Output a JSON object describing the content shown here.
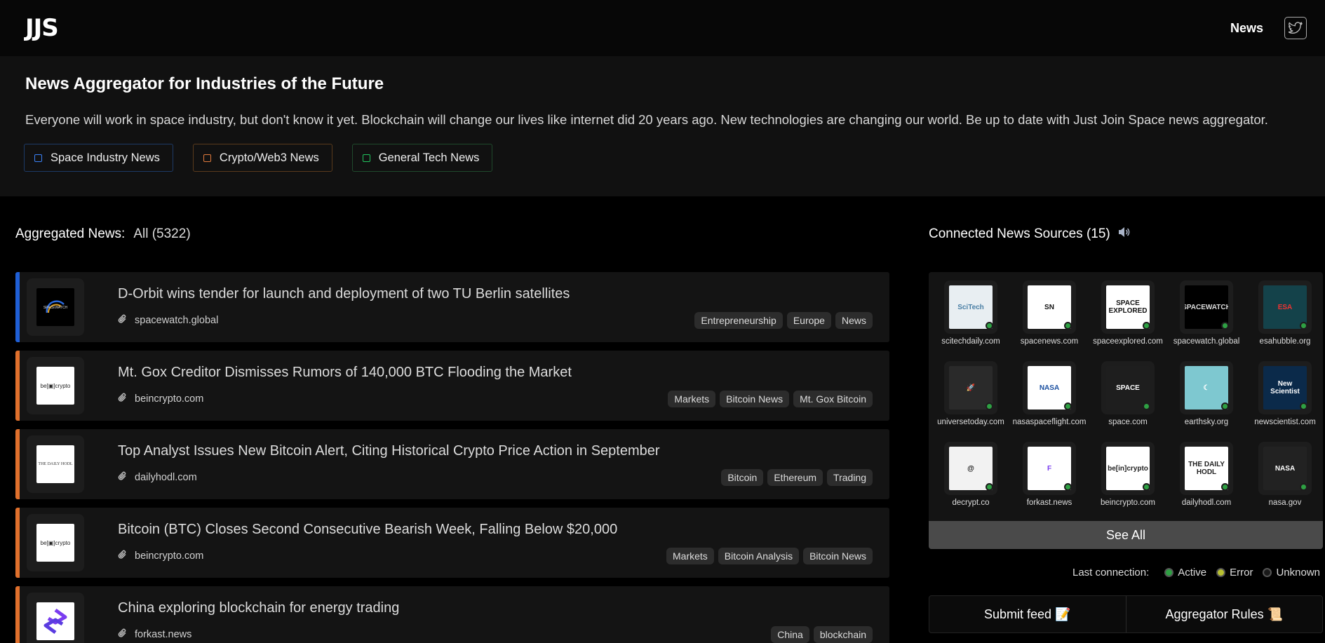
{
  "brand": {
    "logo": "JJS"
  },
  "nav": {
    "news": "News",
    "twitter_icon": "twitter-icon"
  },
  "hero": {
    "title": "News Aggregator for Industries of the Future",
    "description": "Everyone will work in space industry, but don't know it yet. Blockchain will change our lives like internet did 20 years ago. New technologies are changing our world. Be up to date with Just Join Space news aggregator.",
    "filters": [
      {
        "label": "Space Industry News",
        "color": "#3b82f6"
      },
      {
        "label": "Crypto/Web3 News",
        "color": "#e07a3c"
      },
      {
        "label": "General Tech News",
        "color": "#22c55e"
      }
    ]
  },
  "aggregated": {
    "title": "Aggregated News:",
    "filter": "All (5322)",
    "items": [
      {
        "title": "D-Orbit wins tender for launch and deployment of two TU Berlin satellites",
        "source": "spacewatch.global",
        "tags": [
          "Entrepreneurship",
          "Europe",
          "News"
        ],
        "accent": "#1f5fd6",
        "logo": "spacewatch"
      },
      {
        "title": "Mt. Gox Creditor Dismisses Rumors of 140,000 BTC Flooding the Market",
        "source": "beincrypto.com",
        "tags": [
          "Markets",
          "Bitcoin News",
          "Mt. Gox Bitcoin"
        ],
        "accent": "#e0702c",
        "logo": "beincrypto"
      },
      {
        "title": "Top Analyst Issues New Bitcoin Alert, Citing Historical Crypto Price Action in September",
        "source": "dailyhodl.com",
        "tags": [
          "Bitcoin",
          "Ethereum",
          "Trading"
        ],
        "accent": "#e0702c",
        "logo": "dailyhodl"
      },
      {
        "title": "Bitcoin (BTC) Closes Second Consecutive Bearish Week, Falling Below $20,000",
        "source": "beincrypto.com",
        "tags": [
          "Markets",
          "Bitcoin Analysis",
          "Bitcoin News"
        ],
        "accent": "#e0702c",
        "logo": "beincrypto"
      },
      {
        "title": "China exploring blockchain for energy trading",
        "source": "forkast.news",
        "tags": [
          "China",
          "blockchain"
        ],
        "accent": "#e0702c",
        "logo": "forkast"
      }
    ]
  },
  "sources": {
    "title": "Connected News Sources (15)",
    "speaker_icon": "speaker-icon",
    "items": [
      {
        "name": "scitechdaily.com",
        "logo_text": "SciTech",
        "bg": "#e8eef2",
        "fg": "#4a7fa5",
        "status": "#2ea043"
      },
      {
        "name": "spacenews.com",
        "logo_text": "SN",
        "bg": "#ffffff",
        "fg": "#111",
        "status": "#2ea043"
      },
      {
        "name": "spaceexplored.com",
        "logo_text": "SPACE EXPLORED",
        "bg": "#ffffff",
        "fg": "#111",
        "status": "#2ea043"
      },
      {
        "name": "spacewatch.global",
        "logo_text": "SPACEWATCH",
        "bg": "#000000",
        "fg": "#ddd",
        "status": "#2ea043"
      },
      {
        "name": "esahubble.org",
        "logo_text": "ESA",
        "bg": "#14424a",
        "fg": "#e33",
        "status": "#2ea043"
      },
      {
        "name": "universetoday.com",
        "logo_text": "🚀",
        "bg": "#2a2a2a",
        "fg": "#9b8cf0",
        "status": "#2ea043"
      },
      {
        "name": "nasaspaceflight.com",
        "logo_text": "NASA",
        "bg": "#ffffff",
        "fg": "#1a4fa0",
        "status": "#2ea043"
      },
      {
        "name": "space.com",
        "logo_text": "SPACE",
        "bg": "#1e1e1e",
        "fg": "#fff",
        "status": "#2ea043"
      },
      {
        "name": "earthsky.org",
        "logo_text": "☾",
        "bg": "#7ec8d0",
        "fg": "#fff",
        "status": "#2ea043"
      },
      {
        "name": "newscientist.com",
        "logo_text": "New Scientist",
        "bg": "#0b2a4a",
        "fg": "#fff",
        "status": "#2ea043"
      },
      {
        "name": "decrypt.co",
        "logo_text": "@",
        "bg": "#f2f2f2",
        "fg": "#111",
        "status": "#2ea043"
      },
      {
        "name": "forkast.news",
        "logo_text": "F",
        "bg": "#ffffff",
        "fg": "#7a3cf0",
        "status": "#2ea043"
      },
      {
        "name": "beincrypto.com",
        "logo_text": "be[in]crypto",
        "bg": "#ffffff",
        "fg": "#222",
        "status": "#2ea043"
      },
      {
        "name": "dailyhodl.com",
        "logo_text": "THE DAILY HODL",
        "bg": "#ffffff",
        "fg": "#222",
        "status": "#2ea043"
      },
      {
        "name": "nasa.gov",
        "logo_text": "NASA",
        "bg": "#222222",
        "fg": "#fff",
        "status": "#2ea043"
      }
    ],
    "see_all": "See All"
  },
  "legend": {
    "label": "Last connection:",
    "items": [
      {
        "label": "Active",
        "color": "#2ea043"
      },
      {
        "label": "Error",
        "color": "#b8c030"
      },
      {
        "label": "Unknown",
        "color": "#1a1a1a"
      }
    ]
  },
  "actions": {
    "submit": "Submit feed 📝",
    "rules": "Aggregator Rules 📜"
  }
}
